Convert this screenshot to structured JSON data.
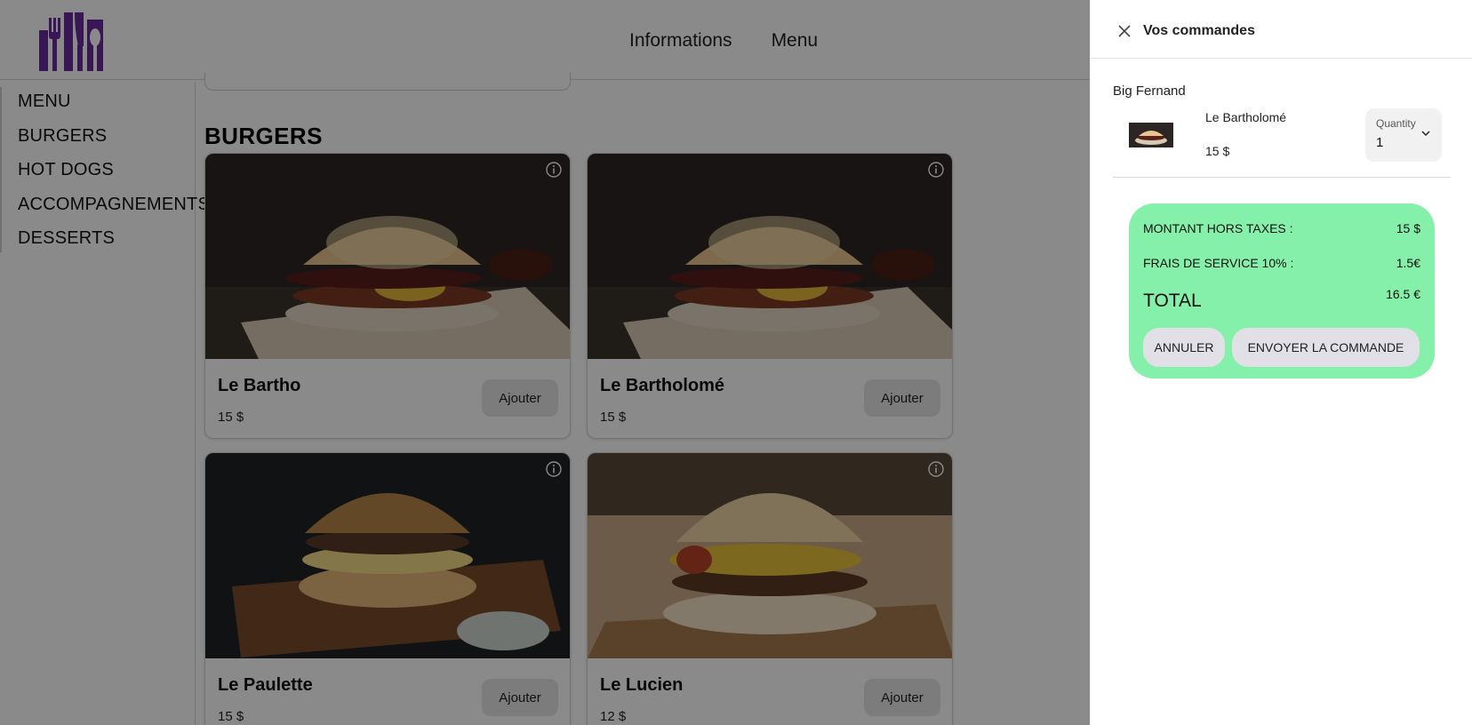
{
  "header": {
    "nav": [
      "Informations",
      "Menu"
    ],
    "logo": "restaurant-logo-icon"
  },
  "sidebar": {
    "items": [
      {
        "label": "MENU"
      },
      {
        "label": "BURGERS"
      },
      {
        "label": "HOT DOGS"
      },
      {
        "label": "ACCOMPAGNEMENTS"
      },
      {
        "label": "DESSERTS"
      }
    ]
  },
  "section": {
    "title": "BURGERS"
  },
  "products": [
    {
      "name": "Le Bartho",
      "price": "15 $",
      "add_label": "Ajouter"
    },
    {
      "name": "Le Bartholomé",
      "price": "15 $",
      "add_label": "Ajouter"
    },
    {
      "name": "Le Paulette",
      "price": "15 $",
      "add_label": "Ajouter"
    },
    {
      "name": "Le Lucien",
      "price": "12 $",
      "add_label": "Ajouter"
    }
  ],
  "drawer": {
    "title": "Vos commandes",
    "restaurant": "Big Fernand",
    "order": {
      "item_name": "Le Bartholomé",
      "item_price": "15 $",
      "quantity_label": "Quantity",
      "quantity_value": "1"
    },
    "summary": {
      "subtotal_label": "MONTANT HORS TAXES :",
      "subtotal_value": "15 $",
      "service_label": "FRAIS DE SERVICE 10% :",
      "service_value": "1.5€",
      "total_label": "TOTAL",
      "total_value": "16.5 €",
      "cancel_label": "ANNULER",
      "send_label": "ENVOYER LA COMMANDE"
    }
  },
  "colors": {
    "accent": "#6a2a9c",
    "summary_bg": "#85f0a9",
    "overlay": "rgba(0,0,0,0.46)"
  }
}
